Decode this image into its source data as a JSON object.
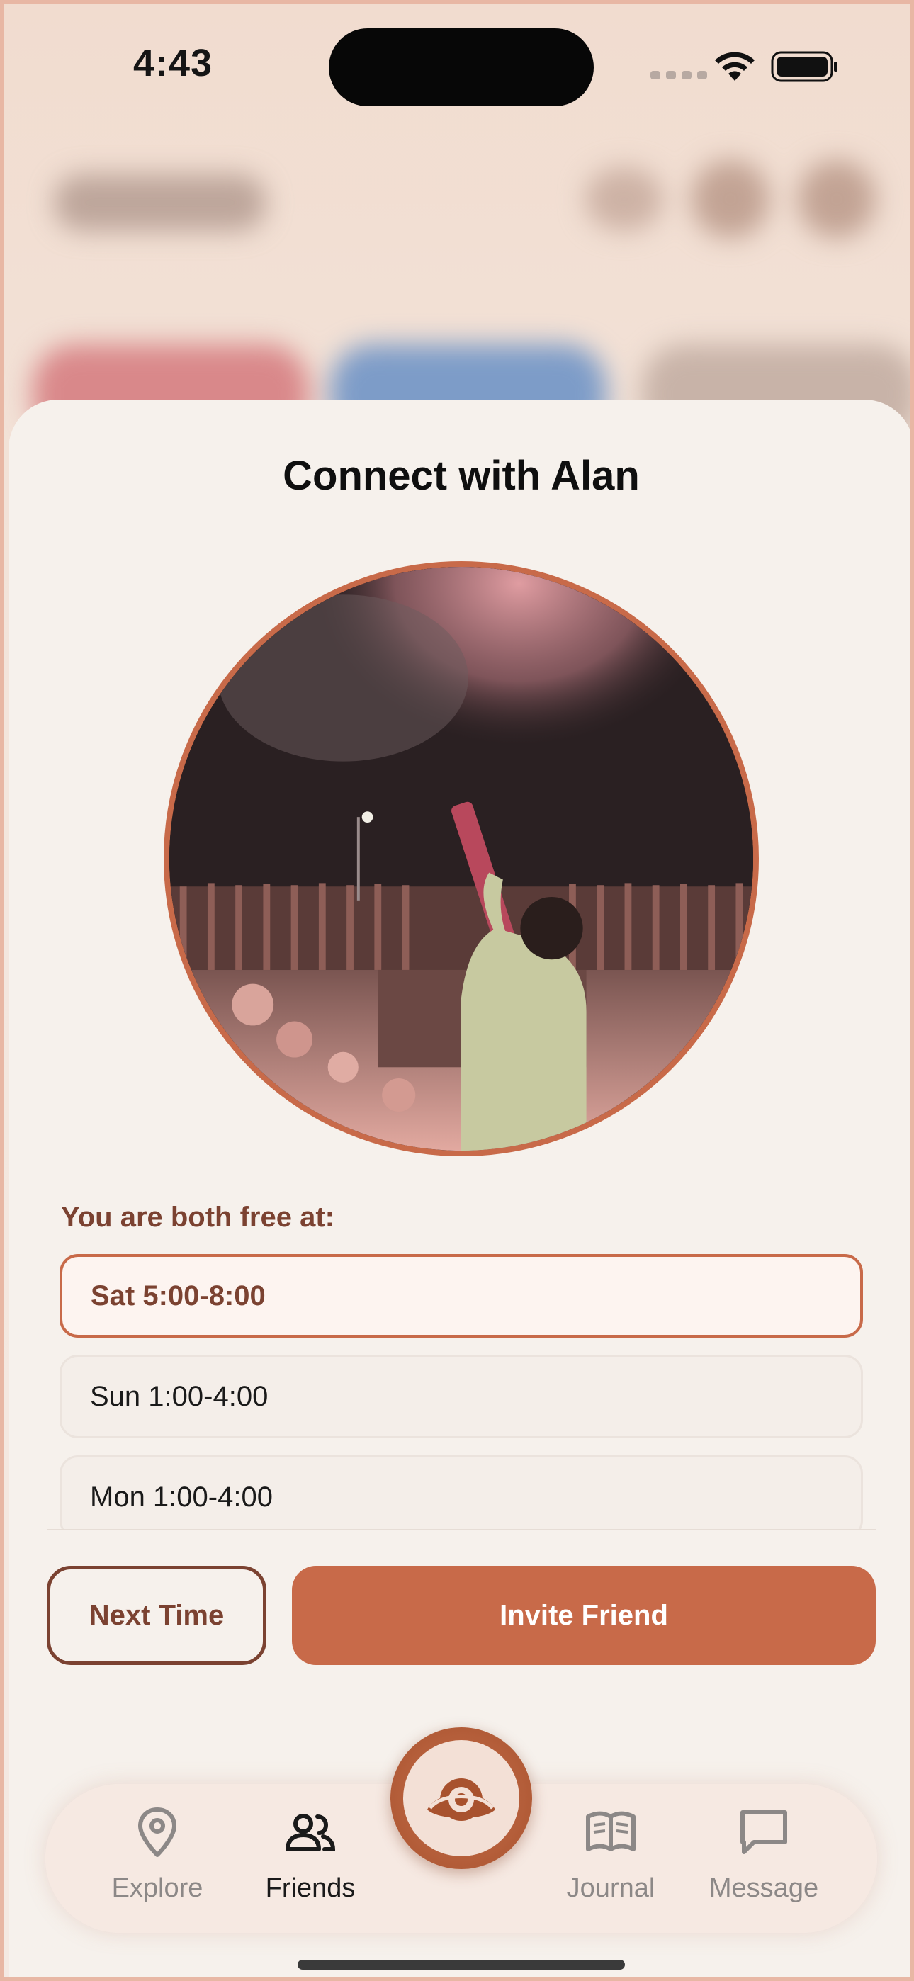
{
  "status_bar": {
    "time": "4:43"
  },
  "sheet": {
    "title": "Connect with Alan",
    "free_label": "You are both free at:",
    "slots": [
      {
        "label": "Sat 5:00-8:00",
        "selected": true
      },
      {
        "label": "Sun 1:00-4:00",
        "selected": false
      },
      {
        "label": "Mon 1:00-4:00",
        "selected": false
      }
    ],
    "actions": {
      "secondary": "Next Time",
      "primary": "Invite Friend"
    }
  },
  "tabbar": {
    "items": [
      {
        "label": "Explore",
        "icon": "map-pin-icon",
        "active": false
      },
      {
        "label": "Friends",
        "icon": "people-icon",
        "active": true
      },
      {
        "label": "Journal",
        "icon": "book-icon",
        "active": false
      },
      {
        "label": "Message",
        "icon": "chat-icon",
        "active": false
      }
    ],
    "center_icon": "eye-logo-icon"
  },
  "colors": {
    "accent": "#c86a49",
    "accent_dark": "#7b4231",
    "sheet_bg": "#f6f1ec"
  }
}
